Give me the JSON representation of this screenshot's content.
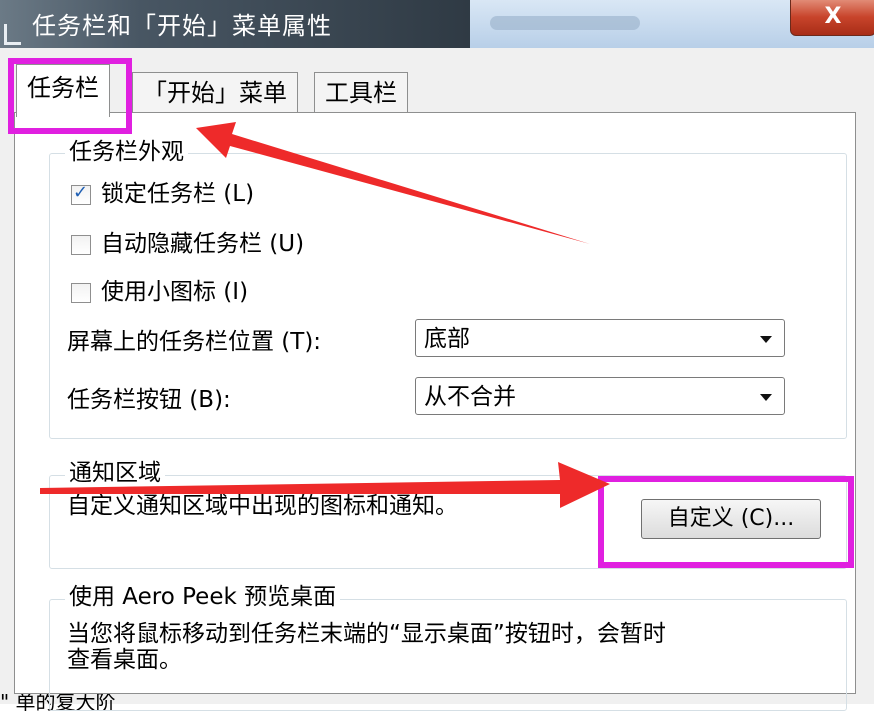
{
  "window": {
    "title": "任务栏和「开始」菜单属性",
    "close_symbol": "X"
  },
  "tabs": [
    {
      "label": "任务栏",
      "active": true
    },
    {
      "label": "「开始」菜单",
      "active": false
    },
    {
      "label": "工具栏",
      "active": false
    }
  ],
  "appearance": {
    "legend": "任务栏外观",
    "lock_taskbar": {
      "label": "锁定任务栏 (L)",
      "checked": true
    },
    "auto_hide": {
      "label": "自动隐藏任务栏 (U)",
      "checked": false
    },
    "small_icons": {
      "label": "使用小图标 (I)",
      "checked": false
    },
    "location_label": "屏幕上的任务栏位置 (T):",
    "location_value": "底部",
    "buttons_label": "任务栏按钮 (B):",
    "buttons_value": "从不合并"
  },
  "notification": {
    "legend": "通知区域",
    "description": "自定义通知区域中出现的图标和通知。",
    "customize_button": "自定义 (C)..."
  },
  "aero_peek": {
    "legend": "使用 Aero Peek 预览桌面",
    "description_line1": "当您将鼠标移动到任务栏末端的“显示桌面”按钮时，会暂时",
    "description_line2": "查看桌面。"
  },
  "bottom_caption": "\"  单的复大阶",
  "colors": {
    "highlight": "#e020e0",
    "arrow": "#ee2a2a"
  }
}
